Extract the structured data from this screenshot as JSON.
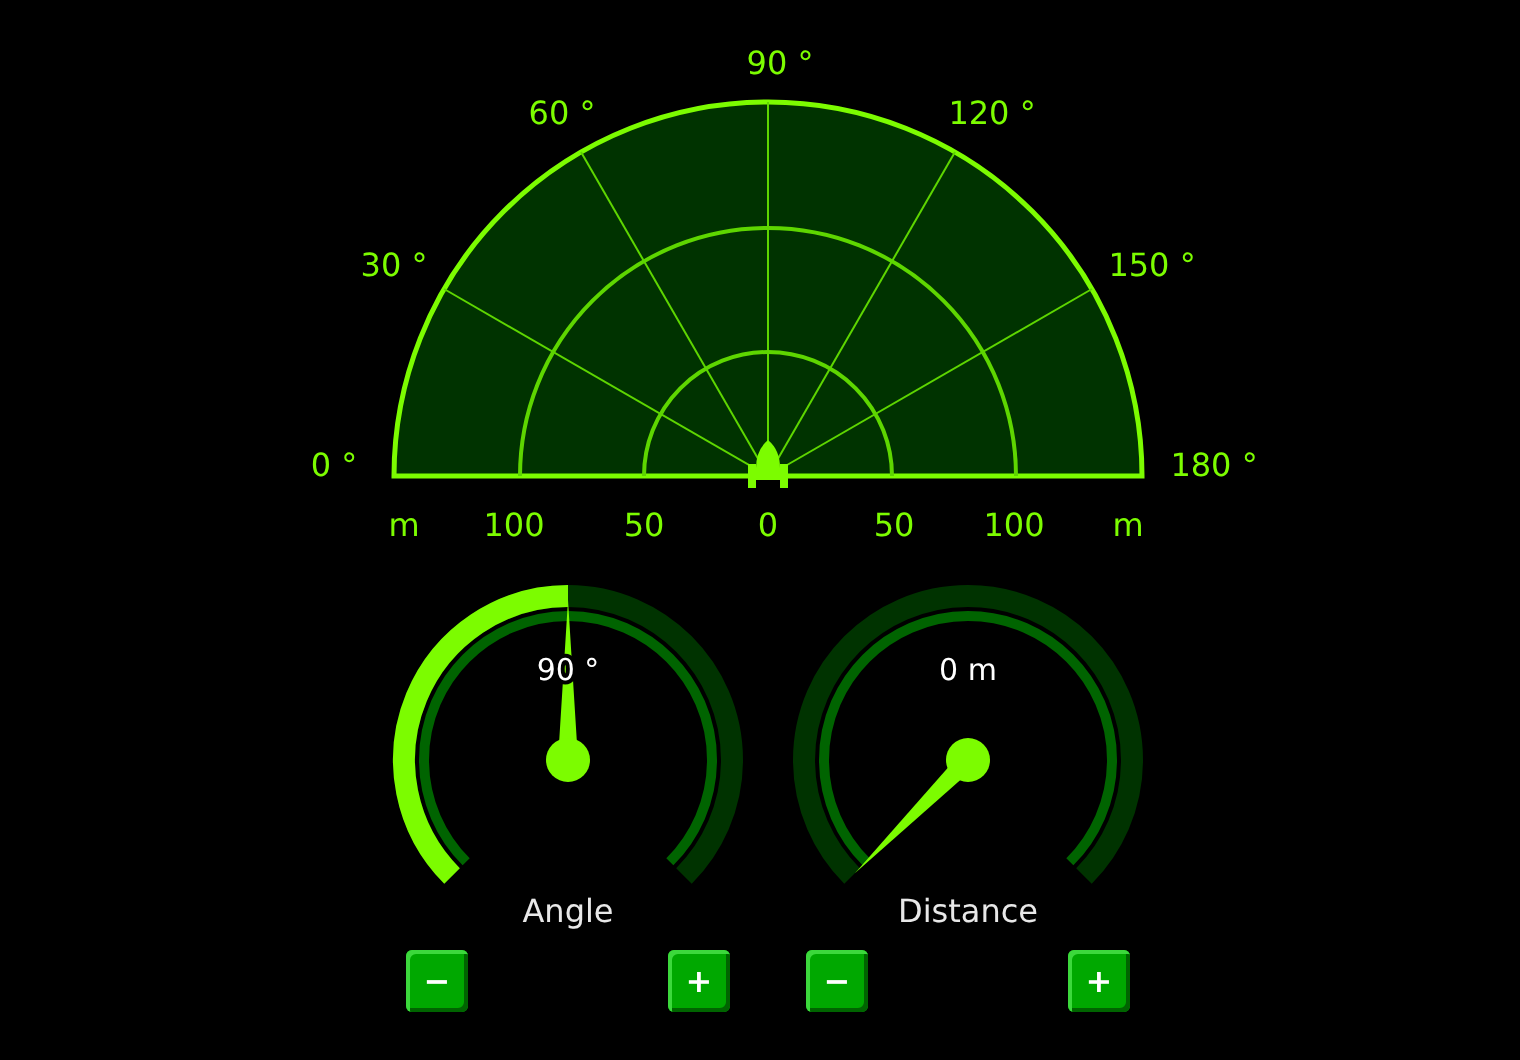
{
  "radar": {
    "angle_labels": [
      "0 °",
      "30 °",
      "60 °",
      "90 °",
      "120 °",
      "150 °",
      "180 °"
    ],
    "distance_labels": [
      "m",
      "100",
      "50",
      "0",
      "50",
      "100",
      "m"
    ]
  },
  "gauges": [
    {
      "label": "Angle",
      "reading": "90 °",
      "buttons": [
        "−",
        "+"
      ]
    },
    {
      "label": "Distance",
      "reading": "0 m",
      "buttons": [
        "−",
        "+"
      ]
    }
  ]
}
